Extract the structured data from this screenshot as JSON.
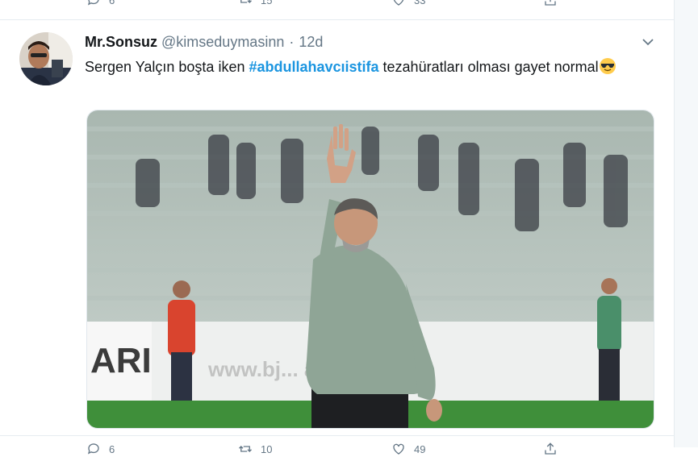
{
  "top_actions": {
    "reply_count": "6",
    "retweet_count": "15",
    "like_count": "33"
  },
  "tweet": {
    "display_name": "Mr.Sonsuz",
    "handle": "@kimseduymasinn",
    "separator": "·",
    "time": "12d",
    "text_before": "Sergen Yalçın boşta iken ",
    "hashtag": "#abdullahavcıistifa",
    "text_after": " tezahüratları olması gayet normal",
    "emoji": "smiling-face-with-sunglasses",
    "media_board_text_left": "ARI",
    "media_board_text_right": "www.bj... ataşva..."
  },
  "bottom_actions": {
    "reply_count": "6",
    "retweet_count": "10",
    "like_count": "49"
  },
  "colors": {
    "link": "#1b95e0",
    "muted": "#657786",
    "divider": "#e6ecf0"
  }
}
